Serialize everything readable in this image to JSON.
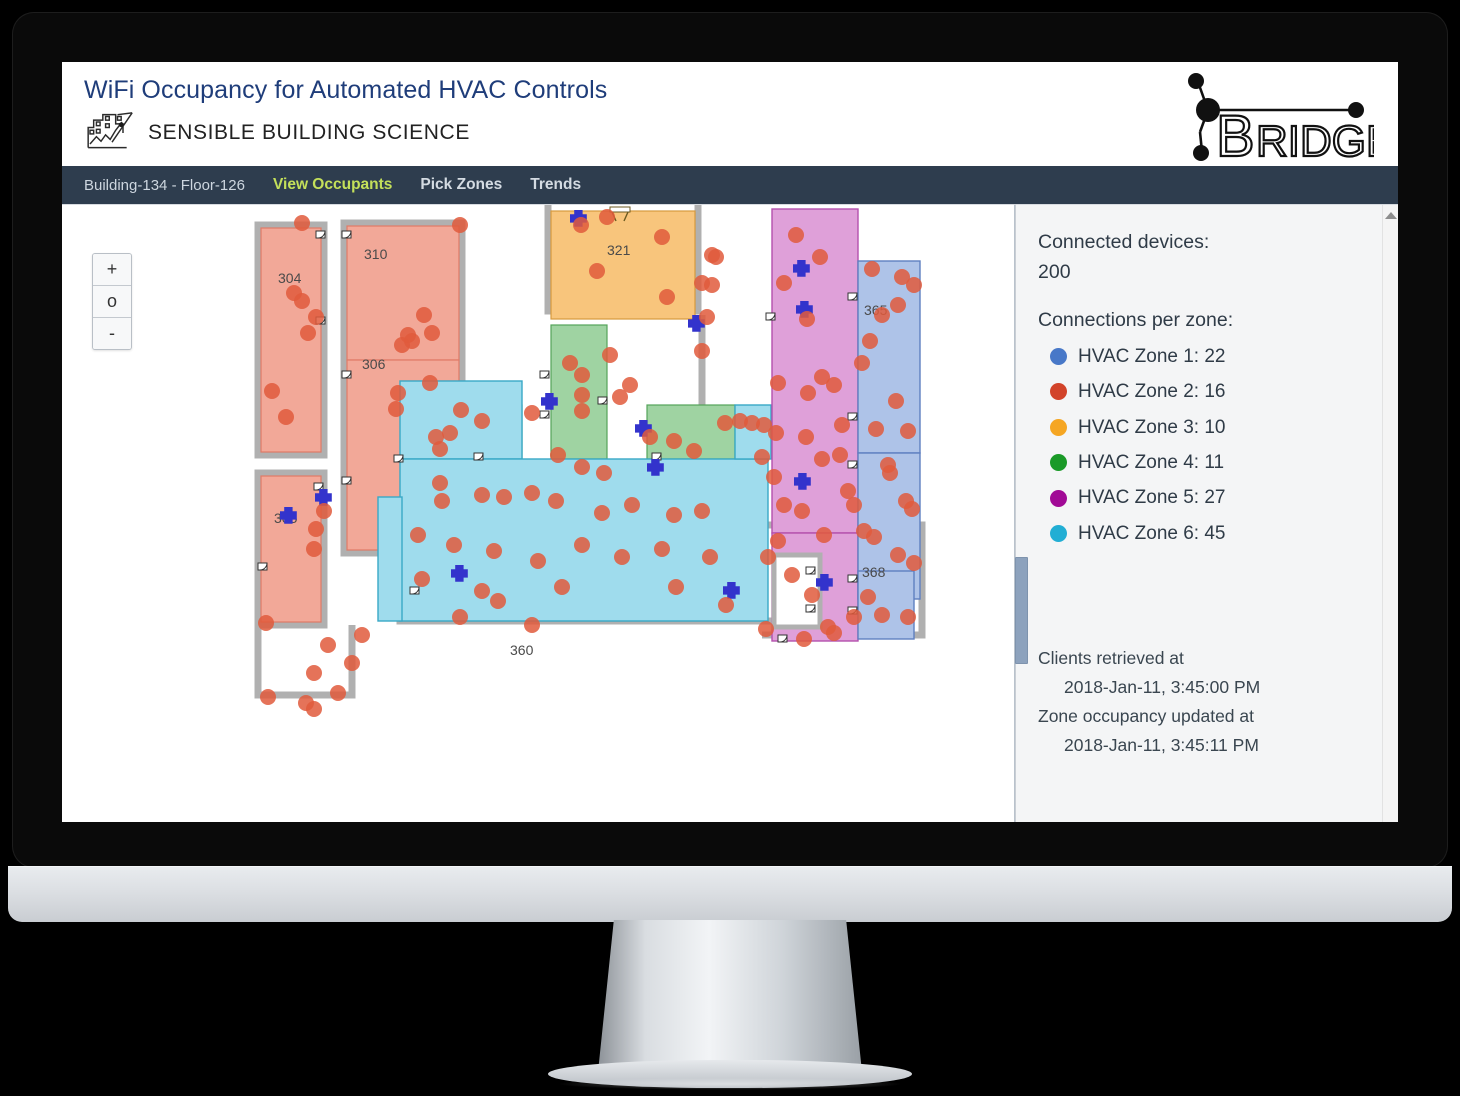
{
  "header": {
    "title": "WiFi Occupancy for Automated HVAC Controls",
    "brand": "SENSIBLE BUILDING SCIENCE",
    "logo_icon": "sensible-building-science-logo",
    "partner_logo_text": "BRIDGE",
    "partner_logo_icon": "bridge-network-node-logo"
  },
  "nav": {
    "breadcrumb_building": "Building-134",
    "breadcrumb_separator": "-",
    "breadcrumb_floor": "Floor-126",
    "items": [
      {
        "label": "View Occupants",
        "active": true
      },
      {
        "label": "Pick Zones",
        "active": false
      },
      {
        "label": "Trends",
        "active": false
      }
    ],
    "active_color": "#c4e05a",
    "background": "#2e3d4e"
  },
  "map": {
    "zoom_controls": [
      {
        "label": "+",
        "name": "zoom-in-button"
      },
      {
        "label": "o",
        "name": "zoom-reset-button"
      },
      {
        "label": "-",
        "name": "zoom-out-button"
      }
    ],
    "room_labels": [
      "304",
      "310",
      "305",
      "306",
      "321",
      "360",
      "365",
      "368"
    ],
    "device_dot_color": "#e05a3c",
    "access_point_color": "#3333cc",
    "wall_color": "#b0b0b0"
  },
  "sidebar": {
    "connected_devices_label": "Connected devices:",
    "connected_devices_value": "200",
    "connections_label": "Connections per zone:",
    "zones": [
      {
        "label": "HVAC Zone 1: 22",
        "color": "#4878c8",
        "name": "zone-1",
        "count": 22
      },
      {
        "label": "HVAC Zone 2: 16",
        "color": "#d2432a",
        "name": "zone-2",
        "count": 16
      },
      {
        "label": "HVAC Zone 3: 10",
        "color": "#f5a623",
        "name": "zone-3",
        "count": 10
      },
      {
        "label": "HVAC Zone 4: 11",
        "color": "#1a9a28",
        "name": "zone-4",
        "count": 11
      },
      {
        "label": "HVAC Zone 5: 27",
        "color": "#a10a96",
        "name": "zone-5",
        "count": 27
      },
      {
        "label": "HVAC Zone 6: 45",
        "color": "#22aed4",
        "name": "zone-6",
        "count": 45
      }
    ],
    "clients_retrieved_label": "Clients retrieved at",
    "clients_retrieved_time": "2018-Jan-11, 3:45:00 PM",
    "zone_updated_label": "Zone occupancy updated at",
    "zone_updated_time": "2018-Jan-11, 3:45:11 PM"
  }
}
